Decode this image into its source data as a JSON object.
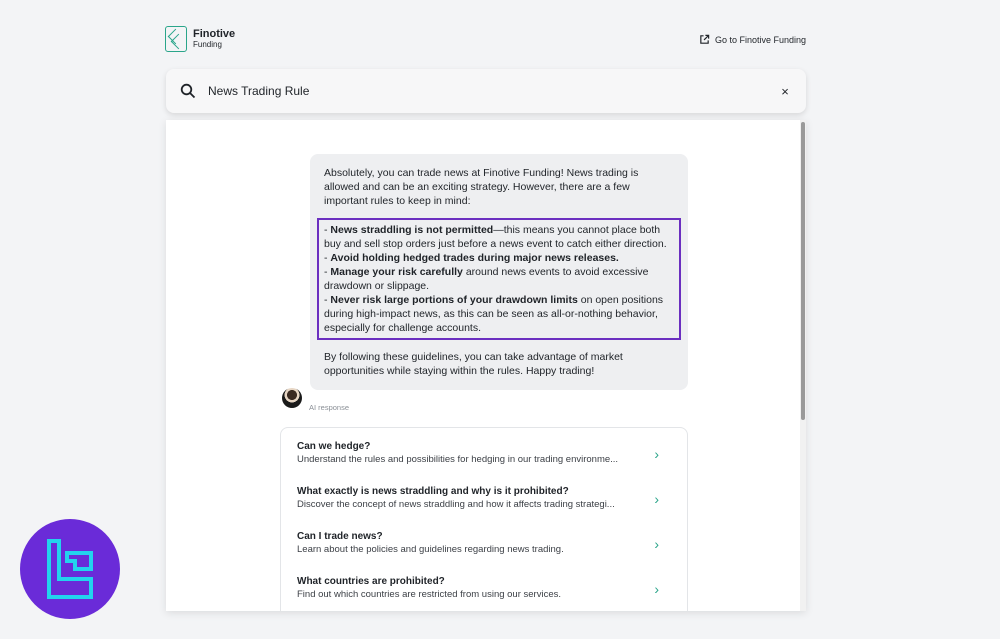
{
  "header": {
    "logo_name": "Finotive",
    "logo_sub": "Funding",
    "goto_label": "Go to Finotive Funding"
  },
  "search": {
    "value": "News Trading Rule",
    "close_label": "×"
  },
  "response": {
    "intro": "Absolutely, you can trade news at Finotive Funding! News trading is allowed and can be an exciting strategy. However, there are a few important rules to keep in mind:",
    "rules": [
      {
        "prefix": "- ",
        "bold": "News straddling is not permitted",
        "rest": "—this means you cannot place both buy and sell stop orders just before a news event to catch either direction."
      },
      {
        "prefix": "- ",
        "bold": "Avoid holding hedged trades during major news releases.",
        "rest": ""
      },
      {
        "prefix": "- ",
        "bold": "Manage your risk carefully",
        "rest": " around news events to avoid excessive drawdown or slippage."
      },
      {
        "prefix": "- ",
        "bold": "Never risk large portions of your drawdown limits",
        "rest": " on open positions during high-impact news, as this can be seen as all-or-nothing behavior, especially for challenge accounts."
      }
    ],
    "outro": "By following these guidelines, you can take advantage of market opportunities while staying within the rules. Happy trading!",
    "ai_label": "AI response"
  },
  "faq": [
    {
      "title": "Can we hedge?",
      "desc": "Understand the rules and possibilities for hedging in our trading environme..."
    },
    {
      "title": "What exactly is news straddling and why is it prohibited?",
      "desc": "Discover the concept of news straddling and how it affects trading strategi..."
    },
    {
      "title": "Can I trade news?",
      "desc": "Learn about the policies and guidelines regarding news trading."
    },
    {
      "title": "What countries are prohibited?",
      "desc": "Find out which countries are restricted from using our services."
    }
  ],
  "colors": {
    "accent": "#2aa58a",
    "highlight_border": "#6b2fc0",
    "brand_circle": "#6a2bd8",
    "brand_glyph": "#22d3ee"
  },
  "icons": {
    "search": "search-icon",
    "close": "close-icon",
    "external": "external-link-icon",
    "chevron": "chevron-right-icon"
  }
}
